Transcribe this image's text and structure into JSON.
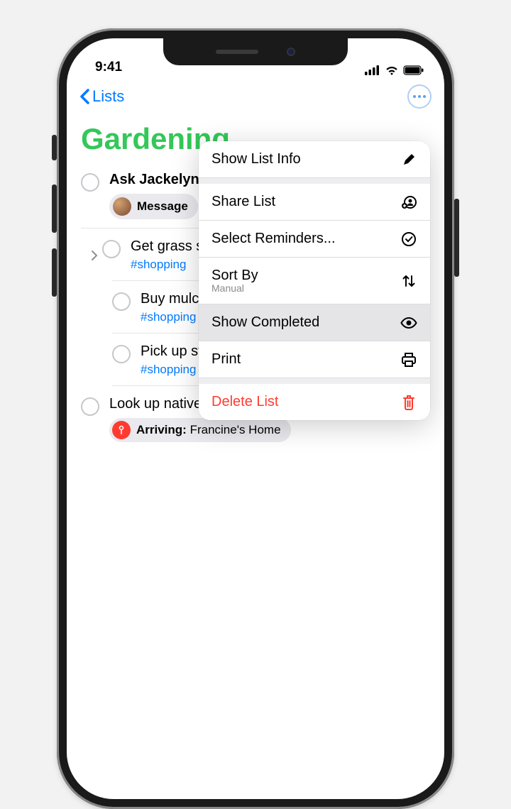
{
  "status_bar": {
    "time": "9:41"
  },
  "nav": {
    "back_label": "Lists"
  },
  "list": {
    "title": "Gardening",
    "items": [
      {
        "title": "Ask Jackelyn about planter boxes",
        "tag": "",
        "msg_pill": "Message"
      },
      {
        "title": "Get grass seed",
        "tag": "#shopping"
      },
      {
        "title": "Buy mulch for herb garden",
        "tag": "#shopping"
      },
      {
        "title": "Pick up stakes for tomato plants",
        "tag": "#shopping"
      },
      {
        "title": "Look up native vines for along the fence",
        "loc_prefix": "Arriving:",
        "loc_name": " Francine's Home"
      }
    ]
  },
  "menu": {
    "show_list_info": "Show List Info",
    "share_list": "Share List",
    "select_reminders": "Select Reminders...",
    "sort_by": "Sort By",
    "sort_by_value": "Manual",
    "show_completed": "Show Completed",
    "print": "Print",
    "delete_list": "Delete List"
  }
}
